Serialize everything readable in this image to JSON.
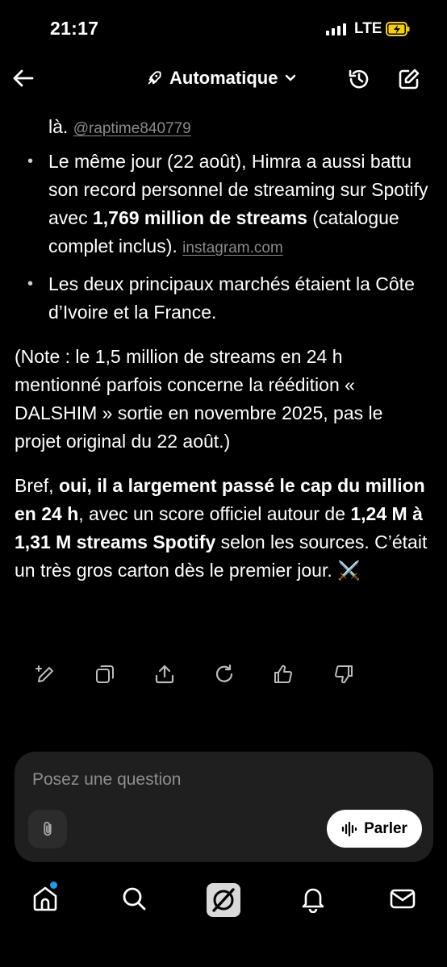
{
  "status_bar": {
    "time": "21:17",
    "network": "LTE"
  },
  "nav": {
    "model_label": "Automatique"
  },
  "content": {
    "intro_fragment": "là.",
    "intro_source": "@raptime840779",
    "bullet1": {
      "text_before": "Le même jour (22 août), Himra a aussi battu son record personnel de streaming sur Spotify avec ",
      "bold": "1,769 million de streams",
      "text_after": " (catalogue complet inclus).",
      "source": "instagram.com"
    },
    "bullet2": {
      "text": "Les deux principaux marchés étaient la Côte d’Ivoire et la France."
    },
    "note": "(Note : le 1,5 million de streams en 24 h mentionné parfois concerne la réédition « DALSHIM » sortie en novembre 2025, pas le projet original du 22 août.)",
    "summary": {
      "lead": "Bref, ",
      "bold1": "oui, il a largement passé le cap du million en 24 h",
      "mid": ", avec un score officiel autour de ",
      "bold2": "1,24 M à 1,31 M streams Spotify",
      "end": " selon les sources. C’était un très gros carton dès le premier jour. ",
      "emoji": "⚔️"
    }
  },
  "composer": {
    "placeholder": "Posez une question",
    "speak_label": "Parler"
  },
  "icons": [
    "arrow-left-icon",
    "rocket-icon",
    "chevron-down-icon",
    "history-icon",
    "edit-icon",
    "edit-sparkle-icon",
    "copy-icon",
    "share-icon",
    "refresh-icon",
    "thumbs-up-icon",
    "thumbs-down-icon",
    "paperclip-icon",
    "waveform-icon",
    "home-icon",
    "search-icon",
    "grok-logo-icon",
    "bell-icon",
    "mail-icon"
  ],
  "colors": {
    "background": "#000000",
    "composer": "#1f1f1f",
    "notification_dot": "#1d9bf0",
    "battery": "#f5d000"
  }
}
